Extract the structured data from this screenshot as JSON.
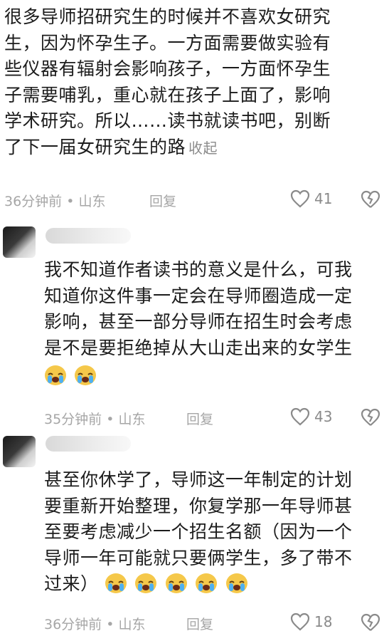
{
  "comments": [
    {
      "lines": [
        "很多导师招研究生的时候并不喜欢女研究",
        "生，因为怀孕生子。一方面需要做实验有",
        "些仪器有辐射会影响孩子，一方面怀孕生",
        "子需要哺乳，重心就在孩子上面了，影响",
        "学术研究。所以……读书就读书吧，别断",
        "了下一届女研究生的路"
      ],
      "collapse": "收起",
      "time": "36分钟前 • 山东",
      "reply": "回复",
      "likes": "41"
    },
    {
      "lines": [
        "我不知道作者读书的意义是什么，可我",
        "知道你这件事一定会在导师圈造成一定",
        "影响，甚至一部分导师在招生时会考虑",
        "是不是要拒绝掉从大山走出来的女学生"
      ],
      "emoji_count": 2,
      "time": "35分钟前 • 山东",
      "reply": "回复",
      "likes": "43"
    },
    {
      "lines": [
        "甚至你休学了，导师这一年制定的计划",
        "要重新开始整理，你复学那一年导师甚",
        "至要考虑减少一个招生名额（因为一个",
        "导师一年可能就只要俩学生，多了带不"
      ],
      "last_line": "过来）",
      "emoji_count": 5,
      "time": "36分钟前 • 山东",
      "reply": "回复",
      "likes": "18"
    }
  ],
  "icons": {
    "like": "heart-outline-icon",
    "dislike": "broken-heart-icon",
    "emoji": "loudly-crying-face-emoji"
  },
  "colors": {
    "meta": "#a6a6a6",
    "text": "#1c1c1c",
    "emoji": "#f5c84a"
  }
}
